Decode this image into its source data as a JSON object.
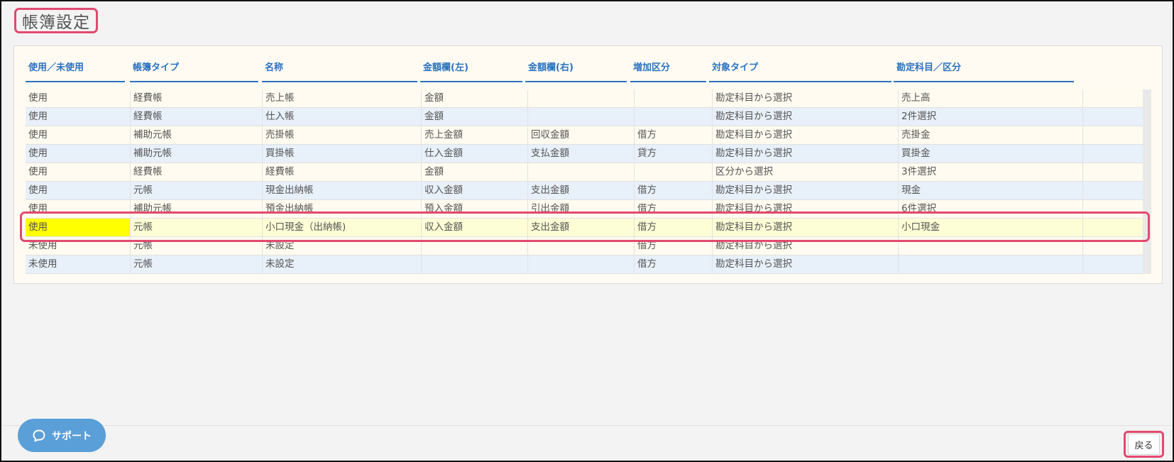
{
  "page": {
    "title": "帳簿設定"
  },
  "table": {
    "columns": [
      "使用／未使用",
      "帳簿タイプ",
      "名称",
      "金額欄(左)",
      "金額欄(右)",
      "増加区分",
      "対象タイプ",
      "勘定科目／区分"
    ],
    "rows": [
      [
        "使用",
        "経費帳",
        "売上帳",
        "金額",
        "",
        "",
        "勘定科目から選択",
        "売上高"
      ],
      [
        "使用",
        "経費帳",
        "仕入帳",
        "金額",
        "",
        "",
        "勘定科目から選択",
        "2件選択"
      ],
      [
        "使用",
        "補助元帳",
        "売掛帳",
        "売上金額",
        "回収金額",
        "借方",
        "勘定科目から選択",
        "売掛金"
      ],
      [
        "使用",
        "補助元帳",
        "買掛帳",
        "仕入金額",
        "支払金額",
        "貸方",
        "勘定科目から選択",
        "買掛金"
      ],
      [
        "使用",
        "経費帳",
        "経費帳",
        "金額",
        "",
        "",
        "区分から選択",
        "3件選択"
      ],
      [
        "使用",
        "元帳",
        "現金出納帳",
        "収入金額",
        "支出金額",
        "借方",
        "勘定科目から選択",
        "現金"
      ],
      [
        "使用",
        "補助元帳",
        "預金出納帳",
        "預入金額",
        "引出金額",
        "借方",
        "勘定科目から選択",
        "6件選択"
      ],
      [
        "使用",
        "元帳",
        "小口現金（出納帳)",
        "収入金額",
        "支出金額",
        "借方",
        "勘定科目から選択",
        "小口現金"
      ],
      [
        "未使用",
        "元帳",
        "未設定",
        "",
        "",
        "借方",
        "勘定科目から選択",
        ""
      ],
      [
        "未使用",
        "元帳",
        "未設定",
        "",
        "",
        "借方",
        "勘定科目から選択",
        ""
      ]
    ],
    "selected_row": 7
  },
  "footer": {
    "support_label": "サポート",
    "back_label": "戻る"
  },
  "colors": {
    "header_blue": "#2a72c0",
    "highlight_red": "#e24a6e",
    "selected_cell": "#ffff00",
    "support_button": "#5a9fd8"
  }
}
